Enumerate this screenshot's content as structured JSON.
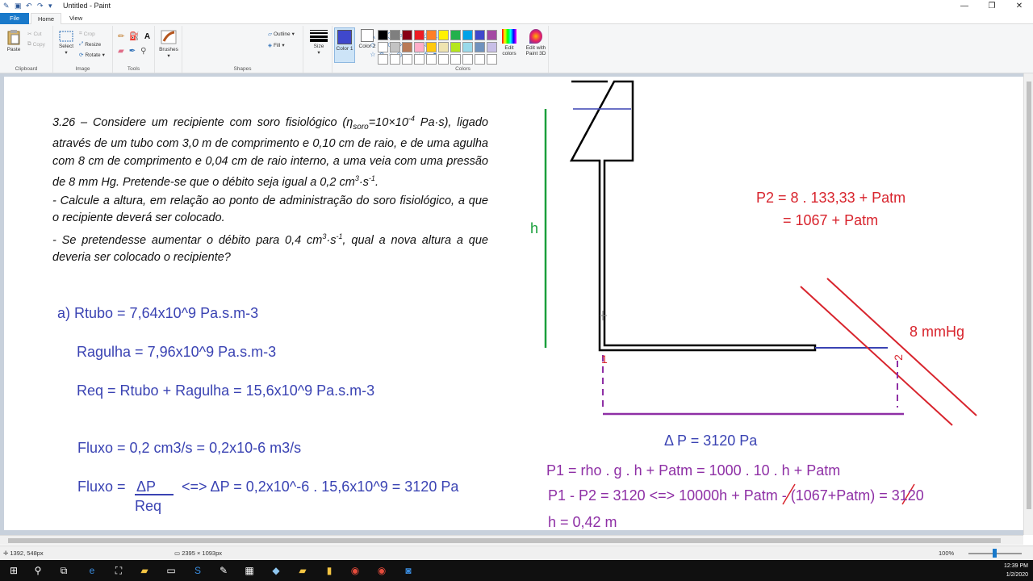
{
  "window": {
    "title": "Untitled - Paint",
    "controls": [
      "—",
      "❐",
      "✕"
    ]
  },
  "tabs": {
    "file": "File",
    "home": "Home",
    "view": "View"
  },
  "ribbon": {
    "clipboard": {
      "label": "Clipboard",
      "paste": "Paste",
      "cut": "Cut",
      "copy": "Copy"
    },
    "image": {
      "label": "Image",
      "select": "Select",
      "crop": "Crop",
      "resize": "Resize",
      "rotate": "Rotate"
    },
    "tools": {
      "label": "Tools"
    },
    "brushes": "Brushes",
    "shapes": {
      "label": "Shapes",
      "outline": "Outline",
      "fill": "Fill"
    },
    "size": "Size",
    "color1": "Color 1",
    "color2": "Color 2",
    "colors": {
      "label": "Colors",
      "edit": "Edit colors",
      "paint3d": "Edit with Paint 3D"
    },
    "palette": [
      "#000000",
      "#7f7f7f",
      "#880015",
      "#ed1c24",
      "#ff7f27",
      "#fff200",
      "#22b14c",
      "#00a2e8",
      "#3f48cc",
      "#a349a4",
      "#ffffff",
      "#c3c3c3",
      "#b97a57",
      "#ffaec9",
      "#ffc90e",
      "#efe4b0",
      "#b5e61d",
      "#99d9ea",
      "#7092be",
      "#c8bfe7",
      "#ffffff",
      "#ffffff",
      "#ffffff",
      "#ffffff",
      "#ffffff",
      "#ffffff",
      "#ffffff",
      "#ffffff",
      "#ffffff",
      "#ffffff"
    ],
    "color1_value": "#3f48cc",
    "color2_value": "#ffffff"
  },
  "problem": {
    "p1": "3.26 – Considere um recipiente com soro fisiológico (ηsoro=10×10-4 Pa·s), ligado através de um tubo com 3,0 m de comprimento e 0,10 cm de raio, e de uma agulha com 8 cm de comprimento e 0,04 cm de raio interno, a uma veia com uma pressão de 8 mm Hg. Pretende-se que o débito seja igual a 0,2 cm3·s-1.",
    "p2": "- Calcule a altura, em relação ao ponto de administração do soro fisiológico, a que o recipiente deverá ser colocado.",
    "p3": "- Se pretendesse aumentar o débito para 0,4 cm3·s-1, qual a nova altura a que deveria ser colocado o recipiente?"
  },
  "solution": {
    "rtubo": "a) Rtubo = 7,64x10^9 Pa.s.m-3",
    "ragulha": "Ragulha = 7,96x10^9 Pa.s.m-3",
    "req": "Req = Rtubo + Ragulha = 15,6x10^9 Pa.s.m-3",
    "fluxo1": "Fluxo = 0,2 cm3/s = 0,2x10-6 m3/s",
    "fluxo2_left": "Fluxo =",
    "fluxo2_num": "ΔP",
    "fluxo2_den": "Req",
    "fluxo2_right": "<=> ΔP = 0,2x10^-6 . 15,6x10^9 = 3120 Pa"
  },
  "diagram": {
    "h_label": "h",
    "p2_line1": "P2 =  8 . 133,33 + Patm",
    "p2_line2": "= 1067 + Patm",
    "mmhg": "8 mmHg",
    "mark1": "1",
    "mark2": "2",
    "deltap": "Δ P = 3120 Pa",
    "eq1": "P1 = rho . g . h + Patm = 1000 . 10 . h + Patm",
    "eq2": "P1 - P2 = 3120 <=> 10000h + Patm - (1067+Patm) = 3120",
    "eq3": "h = 0,42 m"
  },
  "status": {
    "position": "1392, 548px",
    "size": "2395 × 1093px",
    "zoom": "100%"
  },
  "taskbar": {
    "time": "12:39 PM",
    "date": "1/2/2020"
  }
}
